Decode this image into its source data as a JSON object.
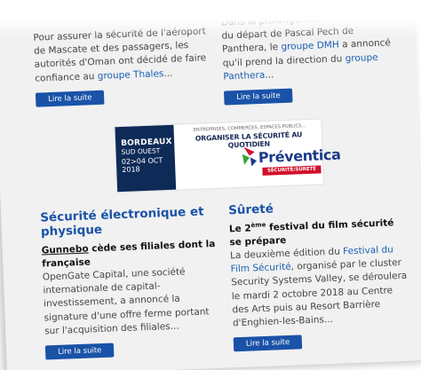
{
  "top_articles": {
    "left": {
      "excerpt_part1": "Pour assurer la sécurité de l'aéroport de Mascate et des passagers, les autorités d'Oman ont décidé de faire confiance au ",
      "excerpt_link": "groupe Thales",
      "excerpt_end": "...",
      "button": "Lire la suite"
    },
    "right": {
      "title_fragment": "Panthera",
      "excerpt_part1": "Dans le prolongement de l'annonce du départ de Pascal Pech de Panthera, le ",
      "excerpt_link1": "groupe DMH",
      "excerpt_part2": " a annoncé qu'il prend la direction du ",
      "excerpt_link2": "groupe Panthera",
      "excerpt_end": "...",
      "button": "Lire la suite"
    }
  },
  "banner": {
    "city": "BORDEAUX",
    "region": "SUD OUEST",
    "dates": "02>04 OCT",
    "year": "2018",
    "top_line": "ENTREPRISES, COMMERCES, ESPACES PUBLICS...",
    "headline": "ORGANISER LA SÉCURITÉ AU QUOTIDIEN",
    "brand": "Préventica",
    "tagline": "SÉCURITÉ/SÛRETÉ",
    "colors": {
      "dark": "#0e2a57",
      "red": "#d2112a",
      "blue": "#1a3a8a",
      "green": "#3aa33a"
    }
  },
  "sections": {
    "left": {
      "title": "Sécurité électronique et physique",
      "article_title_underlined": "Gunnebo",
      "article_title_rest": " cède ses filiales dont la française",
      "excerpt": "OpenGate Capital, une société internationale de capital-investissement, a annoncé la signature d'une offre ferme portant sur l'acquisition des filiales...",
      "button": "Lire la suite"
    },
    "right": {
      "title": "Sûreté",
      "article_title_pre": "Le 2",
      "article_title_sup": "ème",
      "article_title_post": " festival du film sécurité se prépare",
      "excerpt_part1": "La deuxième édition du ",
      "excerpt_link": "Festival du Film Sécurité",
      "excerpt_part2": ", organisé par le cluster Security Systems Valley, se déroulera le mardi 2 octobre 2018 au Centre des Arts puis au Resort Barrière d'Enghien-les-Bains...",
      "button": "Lire la suite"
    }
  },
  "colors": {
    "accent": "#1a52a8",
    "link": "#1a5db0",
    "background": "#f1f1f1"
  }
}
